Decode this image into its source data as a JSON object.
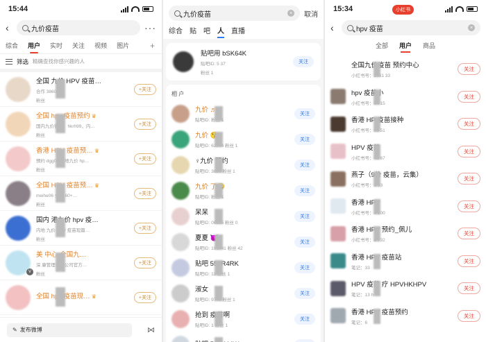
{
  "panel1": {
    "time": "15:44",
    "search_text": "九价疫苗",
    "more": "···",
    "tabs": [
      "综合",
      "用户",
      "实时",
      "关注",
      "视频",
      "图片"
    ],
    "active_tab": 1,
    "plus": "+",
    "filter_label": "筛选",
    "filter_hint": "精确查找你感兴趣的人",
    "follow_label": "+关注",
    "rows": [
      {
        "name": "全国 九价 HPV 疫苗…",
        "sub": "合作 38600",
        "fans": "粉丝",
        "hl": false,
        "color": "#e8d8c8"
      },
      {
        "name": "全国 hpv 疫苗预约",
        "sub": "国内九价微信：hkrh99，内…",
        "fans": "粉丝",
        "hl": true,
        "color": "#f2d6b8",
        "crown": "♛"
      },
      {
        "name": "香港 HPV 疫苗预…",
        "sub": "预约 dgg06 内地九价 hp…",
        "fans": "粉丝",
        "hl": true,
        "color": "#f3c9c9",
        "crown": "♛"
      },
      {
        "name": "全国 HPV 疫苗预…",
        "sub": "meihe06 全国 60+…",
        "fans": "粉丝",
        "hl": true,
        "color": "#8a7f86",
        "crown": "♛"
      },
      {
        "name": "国内 港九价 hpv 疫…",
        "sub": "内地 九价 HPV 疫苗现篇…",
        "fans": "粉丝",
        "hl": false,
        "color": "#3b6fd1"
      },
      {
        "name": "美 中心-全国九…",
        "sub": "深 康管理有限公司官方…",
        "fans": "粉丝",
        "hl": true,
        "color": "#bfe3f0"
      },
      {
        "name": "全国 hpv 疫苗现…",
        "sub": "",
        "fans": "",
        "hl": true,
        "color": "#f3c1c1",
        "crown": "♛"
      }
    ],
    "post_label": "发布微博"
  },
  "panel2": {
    "search_text": "九价疫苗",
    "cancel": "取消",
    "tabs": [
      "综合",
      "贴",
      "吧",
      "人",
      "直播"
    ],
    "active_tab": 3,
    "top_card": {
      "name": "贴吧用 bSK64K",
      "sub1": "贴吧ID: 5 37",
      "sub2": "粉丝 1"
    },
    "follow_label": "关注",
    "section_title": "相 户",
    "rows": [
      {
        "name": "九价 ♬",
        "sub": "贴吧ID:  粉丝 1",
        "hl": true,
        "color": "#c8a08a"
      },
      {
        "name": "九价 😘",
        "sub": "贴吧ID: 62644 粉丝 1",
        "hl": true,
        "color": "#3aa47a"
      },
      {
        "name": "♀九价 预约",
        "sub": "贴吧ID: 3850 粉丝 1",
        "hl": false,
        "color": "#e6d7b0"
      },
      {
        "name": "九价 了😄",
        "sub": "贴吧ID:  粉丝 1",
        "hl": true,
        "color": "#4a8a4a"
      },
      {
        "name": "呆呆",
        "sub": "贴吧ID: 06265 粉丝 0",
        "hl": false,
        "color": "#e8d0d0"
      },
      {
        "name": "夏夏 😈",
        "sub": "贴吧ID: 191941 粉丝 42",
        "hl": false,
        "color": "#d8d8d8"
      },
      {
        "name": "贴吧 553R4RK",
        "sub": "贴吧ID: 11 粉丝 1",
        "hl": false,
        "color": "#c4cbe0"
      },
      {
        "name": "淑女",
        "sub": "贴吧ID: 9749 粉丝 1",
        "hl": false,
        "color": "#cccccc"
      },
      {
        "name": "抢到 疫苗啊",
        "sub": "贴吧ID: 1 粉丝 1",
        "hl": false,
        "color": "#e8b0b0"
      },
      {
        "name": "贴吧 5JZK44W",
        "sub": "",
        "hl": false,
        "color": "#d0d8e0"
      }
    ]
  },
  "panel3": {
    "time": "15:34",
    "badge": "小红书",
    "search_text": "hpv 疫苗",
    "tabs": [
      "全部",
      "用户",
      "商品"
    ],
    "active_tab": 1,
    "follow_label": "关注",
    "rows": [
      {
        "name": "全国九价疫苗 预约中心",
        "sub": "小红书号：2661 33",
        "color": "#ffffff"
      },
      {
        "name": "hpv 疫苗小",
        "sub": "小红书号：64 15",
        "color": "#8a7a70"
      },
      {
        "name": "香港 HP 疫苗接种",
        "sub": "小红书号：96 51",
        "color": "#4a3a30"
      },
      {
        "name": "HPV 疫苗",
        "sub": "小红书号：42 67",
        "color": "#e8c0c8"
      },
      {
        "name": "燕子（9价 疫苗，云集）",
        "sub": "小红书号：6 93",
        "color": "#8a7060"
      },
      {
        "name": "香港 HPV",
        "sub": "小红书号：4 200",
        "color": "#e0e8f0"
      },
      {
        "name": "香港 HPV 预约_佩儿",
        "sub": "小红书号：8 732",
        "color": "#d8a0a8"
      },
      {
        "name": "香港 HPV 疫苗站",
        "sub": "笔记：33",
        "color": "#3a8a8a"
      },
      {
        "name": "HPV 疫苗 疗 HPVHKHPV",
        "sub": "笔记：13 h",
        "color": "#5a5a6a"
      },
      {
        "name": "香港 HPV 疫苗预约",
        "sub": "笔记：6",
        "color": "#a0a8b0"
      }
    ]
  }
}
